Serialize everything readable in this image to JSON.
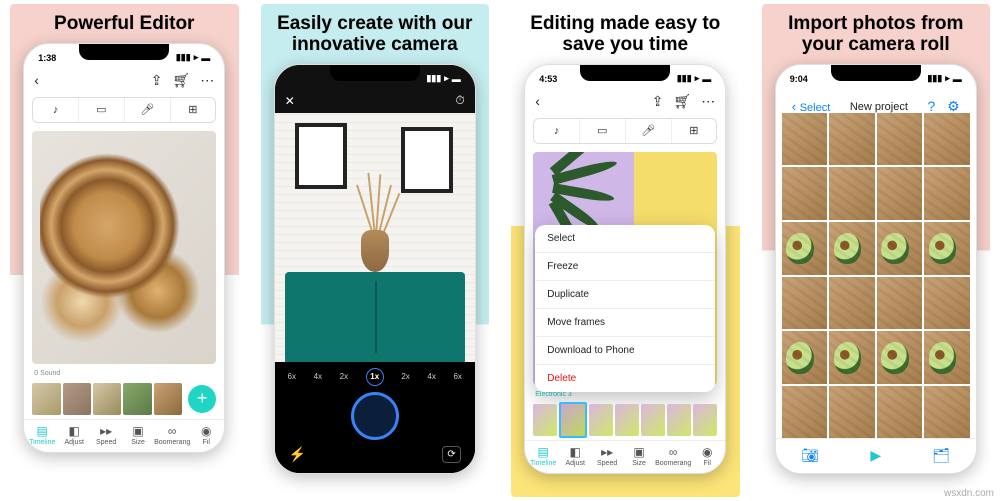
{
  "panels": {
    "p1": {
      "headline": "Powerful Editor",
      "status_time": "1:38",
      "sound_caption": "0 Sound",
      "tabs": [
        "Timeline",
        "Adjust",
        "Speed",
        "Size",
        "Boomerang",
        "Fil"
      ]
    },
    "p2": {
      "headline": "Easily create with our innovative camera",
      "speeds": [
        "6x",
        "4x",
        "2x",
        "1x",
        "2x",
        "4x",
        "6x"
      ]
    },
    "p3": {
      "headline": "Editing made easy to save you time",
      "status_time": "4:53",
      "electronic_caption": "Electronic 3",
      "menu": [
        "Select",
        "Freeze",
        "Duplicate",
        "Move frames",
        "Download to Phone",
        "Delete"
      ],
      "tabs": [
        "Timeline",
        "Adjust",
        "Speed",
        "Size",
        "Boomerang",
        "Fil"
      ]
    },
    "p4": {
      "headline": "Import photos from your camera roll",
      "status_time": "9:04",
      "select_label": "Select",
      "title": "New project"
    }
  },
  "watermark": "wsxdn.com"
}
